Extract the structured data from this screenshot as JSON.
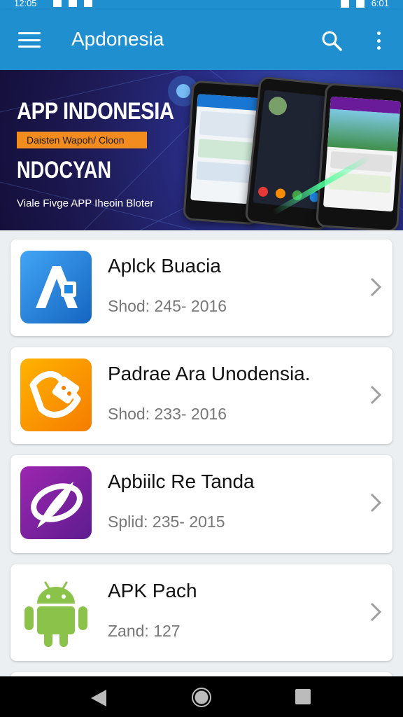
{
  "status_bar": {
    "time_left": "12:05",
    "time_right": "6:01"
  },
  "app_bar": {
    "title": "Apdonesia",
    "menu_icon": "menu-icon",
    "search_icon": "search-icon",
    "more_icon": "more-vert-icon"
  },
  "banner": {
    "title": "APP INDONESIA",
    "tag": "Daisten Wapoh/ Cloon",
    "subtitle": "NDOCYAN",
    "footer": "Viale Fivge APP Iheoin Bloter"
  },
  "apps": [
    {
      "name": "Aplck Buacia",
      "meta": "Shod: 245- 2016",
      "icon": "app-letter-a-icon",
      "color": "#1e88e5"
    },
    {
      "name": "Padrae Ara Unodensia.",
      "meta": "Shod: 233- 2016",
      "icon": "plug-icon",
      "color": "#f7941d"
    },
    {
      "name": "Apbiilc Re Tanda",
      "meta": "Splid: 235- 2015",
      "icon": "feather-swirl-icon",
      "color": "#7e2fb4"
    },
    {
      "name": "APK Pach",
      "meta": "Zand: 127",
      "icon": "android-icon",
      "color": "#8bc34a"
    }
  ],
  "nav_bar": {
    "back_icon": "back-icon",
    "home_icon": "home-icon",
    "recents_icon": "recents-icon"
  }
}
